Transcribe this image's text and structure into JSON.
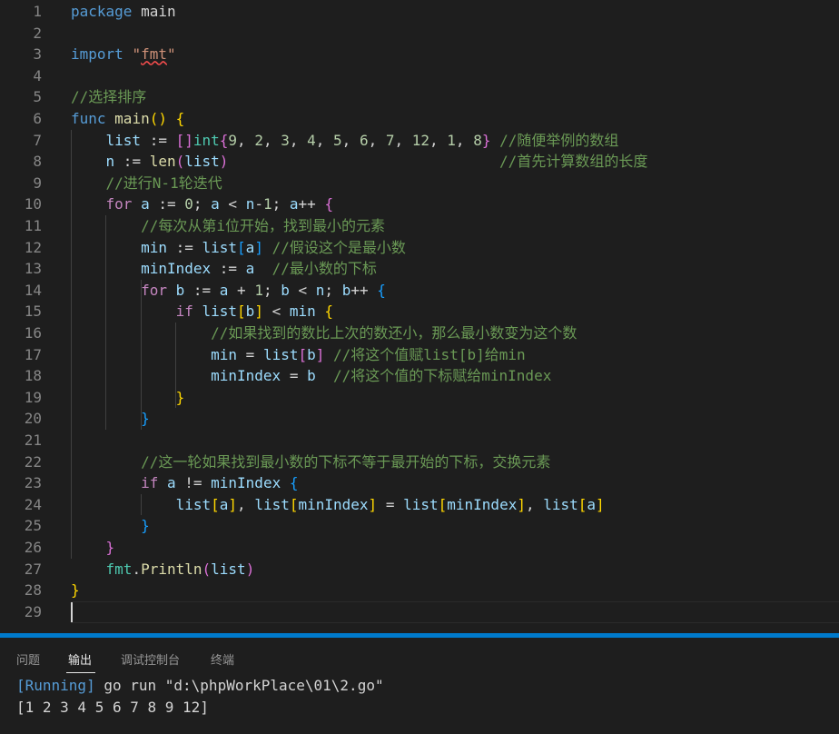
{
  "editor": {
    "line_numbers": [
      "1",
      "2",
      "3",
      "4",
      "5",
      "6",
      "7",
      "8",
      "9",
      "10",
      "11",
      "12",
      "13",
      "14",
      "15",
      "16",
      "17",
      "18",
      "19",
      "20",
      "21",
      "22",
      "23",
      "24",
      "25",
      "26",
      "27",
      "28",
      "29"
    ],
    "lines": [
      [
        {
          "t": "package",
          "c": "kw"
        },
        {
          "t": " main",
          "c": "plain"
        }
      ],
      [],
      [
        {
          "t": "import",
          "c": "kw"
        },
        {
          "t": " ",
          "c": "plain"
        },
        {
          "t": "\"",
          "c": "str"
        },
        {
          "t": "fmt",
          "c": "str",
          "u": true
        },
        {
          "t": "\"",
          "c": "str"
        }
      ],
      [],
      [
        {
          "t": "//选择排序",
          "c": "cmt"
        }
      ],
      [
        {
          "t": "func",
          "c": "kw"
        },
        {
          "t": " ",
          "c": "plain"
        },
        {
          "t": "main",
          "c": "fn"
        },
        {
          "t": "()",
          "c": "b1"
        },
        {
          "t": " ",
          "c": "plain"
        },
        {
          "t": "{",
          "c": "b1"
        }
      ],
      [
        {
          "t": "    ",
          "c": "plain"
        },
        {
          "t": "list",
          "c": "var"
        },
        {
          "t": " := ",
          "c": "plain"
        },
        {
          "t": "[]",
          "c": "b2"
        },
        {
          "t": "int",
          "c": "type"
        },
        {
          "t": "{",
          "c": "b2"
        },
        {
          "t": "9",
          "c": "num"
        },
        {
          "t": ", ",
          "c": "plain"
        },
        {
          "t": "2",
          "c": "num"
        },
        {
          "t": ", ",
          "c": "plain"
        },
        {
          "t": "3",
          "c": "num"
        },
        {
          "t": ", ",
          "c": "plain"
        },
        {
          "t": "4",
          "c": "num"
        },
        {
          "t": ", ",
          "c": "plain"
        },
        {
          "t": "5",
          "c": "num"
        },
        {
          "t": ", ",
          "c": "plain"
        },
        {
          "t": "6",
          "c": "num"
        },
        {
          "t": ", ",
          "c": "plain"
        },
        {
          "t": "7",
          "c": "num"
        },
        {
          "t": ", ",
          "c": "plain"
        },
        {
          "t": "12",
          "c": "num"
        },
        {
          "t": ", ",
          "c": "plain"
        },
        {
          "t": "1",
          "c": "num"
        },
        {
          "t": ", ",
          "c": "plain"
        },
        {
          "t": "8",
          "c": "num"
        },
        {
          "t": "}",
          "c": "b2"
        },
        {
          "t": " //随便举例的数组",
          "c": "cmt"
        }
      ],
      [
        {
          "t": "    ",
          "c": "plain"
        },
        {
          "t": "n",
          "c": "var"
        },
        {
          "t": " := ",
          "c": "plain"
        },
        {
          "t": "len",
          "c": "fn"
        },
        {
          "t": "(",
          "c": "b2"
        },
        {
          "t": "list",
          "c": "var"
        },
        {
          "t": ")",
          "c": "b2"
        },
        {
          "t": "                               ",
          "c": "plain"
        },
        {
          "t": "//首先计算数组的长度",
          "c": "cmt"
        }
      ],
      [
        {
          "t": "    ",
          "c": "plain"
        },
        {
          "t": "//进行N-1轮迭代",
          "c": "cmt"
        }
      ],
      [
        {
          "t": "    ",
          "c": "plain"
        },
        {
          "t": "for",
          "c": "ctl"
        },
        {
          "t": " ",
          "c": "plain"
        },
        {
          "t": "a",
          "c": "var"
        },
        {
          "t": " := ",
          "c": "plain"
        },
        {
          "t": "0",
          "c": "num"
        },
        {
          "t": "; ",
          "c": "plain"
        },
        {
          "t": "a",
          "c": "var"
        },
        {
          "t": " < ",
          "c": "plain"
        },
        {
          "t": "n",
          "c": "var"
        },
        {
          "t": "-",
          "c": "plain"
        },
        {
          "t": "1",
          "c": "num"
        },
        {
          "t": "; ",
          "c": "plain"
        },
        {
          "t": "a",
          "c": "var"
        },
        {
          "t": "++ ",
          "c": "plain"
        },
        {
          "t": "{",
          "c": "b2"
        }
      ],
      [
        {
          "t": "        ",
          "c": "plain"
        },
        {
          "t": "//每次从第i位开始，找到最小的元素",
          "c": "cmt"
        }
      ],
      [
        {
          "t": "        ",
          "c": "plain"
        },
        {
          "t": "min",
          "c": "var"
        },
        {
          "t": " := ",
          "c": "plain"
        },
        {
          "t": "list",
          "c": "var"
        },
        {
          "t": "[",
          "c": "b3"
        },
        {
          "t": "a",
          "c": "var"
        },
        {
          "t": "]",
          "c": "b3"
        },
        {
          "t": " //假设这个是最小数",
          "c": "cmt"
        }
      ],
      [
        {
          "t": "        ",
          "c": "plain"
        },
        {
          "t": "minIndex",
          "c": "var"
        },
        {
          "t": " := ",
          "c": "plain"
        },
        {
          "t": "a",
          "c": "var"
        },
        {
          "t": "  //最小数的下标",
          "c": "cmt"
        }
      ],
      [
        {
          "t": "        ",
          "c": "plain"
        },
        {
          "t": "for",
          "c": "ctl"
        },
        {
          "t": " ",
          "c": "plain"
        },
        {
          "t": "b",
          "c": "var"
        },
        {
          "t": " := ",
          "c": "plain"
        },
        {
          "t": "a",
          "c": "var"
        },
        {
          "t": " + ",
          "c": "plain"
        },
        {
          "t": "1",
          "c": "num"
        },
        {
          "t": "; ",
          "c": "plain"
        },
        {
          "t": "b",
          "c": "var"
        },
        {
          "t": " < ",
          "c": "plain"
        },
        {
          "t": "n",
          "c": "var"
        },
        {
          "t": "; ",
          "c": "plain"
        },
        {
          "t": "b",
          "c": "var"
        },
        {
          "t": "++ ",
          "c": "plain"
        },
        {
          "t": "{",
          "c": "b3"
        }
      ],
      [
        {
          "t": "            ",
          "c": "plain"
        },
        {
          "t": "if",
          "c": "ctl"
        },
        {
          "t": " ",
          "c": "plain"
        },
        {
          "t": "list",
          "c": "var"
        },
        {
          "t": "[",
          "c": "b1"
        },
        {
          "t": "b",
          "c": "var"
        },
        {
          "t": "]",
          "c": "b1"
        },
        {
          "t": " < ",
          "c": "plain"
        },
        {
          "t": "min",
          "c": "var"
        },
        {
          "t": " ",
          "c": "plain"
        },
        {
          "t": "{",
          "c": "b1"
        }
      ],
      [
        {
          "t": "                ",
          "c": "plain"
        },
        {
          "t": "//如果找到的数比上次的数还小，那么最小数变为这个数",
          "c": "cmt"
        }
      ],
      [
        {
          "t": "                ",
          "c": "plain"
        },
        {
          "t": "min",
          "c": "var"
        },
        {
          "t": " = ",
          "c": "plain"
        },
        {
          "t": "list",
          "c": "var"
        },
        {
          "t": "[",
          "c": "b2"
        },
        {
          "t": "b",
          "c": "var"
        },
        {
          "t": "]",
          "c": "b2"
        },
        {
          "t": " //将这个值赋list[b]给min",
          "c": "cmt"
        }
      ],
      [
        {
          "t": "                ",
          "c": "plain"
        },
        {
          "t": "minIndex",
          "c": "var"
        },
        {
          "t": " = ",
          "c": "plain"
        },
        {
          "t": "b",
          "c": "var"
        },
        {
          "t": "  //将这个值的下标赋给minIndex",
          "c": "cmt"
        }
      ],
      [
        {
          "t": "            ",
          "c": "plain"
        },
        {
          "t": "}",
          "c": "b1"
        }
      ],
      [
        {
          "t": "        ",
          "c": "plain"
        },
        {
          "t": "}",
          "c": "b3"
        }
      ],
      [],
      [
        {
          "t": "        ",
          "c": "plain"
        },
        {
          "t": "//这一轮如果找到最小数的下标不等于最开始的下标，交换元素",
          "c": "cmt"
        }
      ],
      [
        {
          "t": "        ",
          "c": "plain"
        },
        {
          "t": "if",
          "c": "ctl"
        },
        {
          "t": " ",
          "c": "plain"
        },
        {
          "t": "a",
          "c": "var"
        },
        {
          "t": " != ",
          "c": "plain"
        },
        {
          "t": "minIndex",
          "c": "var"
        },
        {
          "t": " ",
          "c": "plain"
        },
        {
          "t": "{",
          "c": "b3"
        }
      ],
      [
        {
          "t": "            ",
          "c": "plain"
        },
        {
          "t": "list",
          "c": "var"
        },
        {
          "t": "[",
          "c": "b1"
        },
        {
          "t": "a",
          "c": "var"
        },
        {
          "t": "]",
          "c": "b1"
        },
        {
          "t": ", ",
          "c": "plain"
        },
        {
          "t": "list",
          "c": "var"
        },
        {
          "t": "[",
          "c": "b1"
        },
        {
          "t": "minIndex",
          "c": "var"
        },
        {
          "t": "]",
          "c": "b1"
        },
        {
          "t": " = ",
          "c": "plain"
        },
        {
          "t": "list",
          "c": "var"
        },
        {
          "t": "[",
          "c": "b1"
        },
        {
          "t": "minIndex",
          "c": "var"
        },
        {
          "t": "]",
          "c": "b1"
        },
        {
          "t": ", ",
          "c": "plain"
        },
        {
          "t": "list",
          "c": "var"
        },
        {
          "t": "[",
          "c": "b1"
        },
        {
          "t": "a",
          "c": "var"
        },
        {
          "t": "]",
          "c": "b1"
        }
      ],
      [
        {
          "t": "        ",
          "c": "plain"
        },
        {
          "t": "}",
          "c": "b3"
        }
      ],
      [
        {
          "t": "    ",
          "c": "plain"
        },
        {
          "t": "}",
          "c": "b2"
        }
      ],
      [
        {
          "t": "    ",
          "c": "plain"
        },
        {
          "t": "fmt",
          "c": "type"
        },
        {
          "t": ".",
          "c": "plain"
        },
        {
          "t": "Println",
          "c": "fn"
        },
        {
          "t": "(",
          "c": "b2"
        },
        {
          "t": "list",
          "c": "var"
        },
        {
          "t": ")",
          "c": "b2"
        }
      ],
      [
        {
          "t": "}",
          "c": "b1"
        }
      ],
      []
    ]
  },
  "panel": {
    "tabs": [
      {
        "label": "问题",
        "active": false
      },
      {
        "label": "输出",
        "active": true
      },
      {
        "label": "调试控制台",
        "active": false
      },
      {
        "label": "终端",
        "active": false
      }
    ],
    "output": {
      "running_tag": "[Running]",
      "command": " go run \"d:\\phpWorkPlace\\01\\2.go\"",
      "result": "[1 2 3 4 5 6 7 8 9 12]"
    }
  },
  "colors": {
    "accent": "#007acc",
    "background": "#1e1e1e",
    "comment": "#6a9955",
    "keyword": "#569cd6",
    "control": "#c586c0",
    "variable": "#9cdcfe",
    "number": "#b5cea8",
    "string": "#ce9178"
  }
}
